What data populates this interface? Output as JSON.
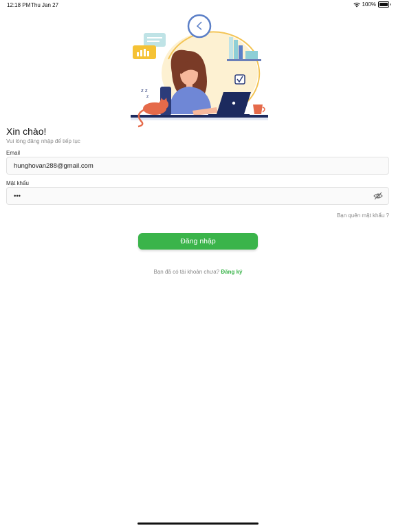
{
  "status": {
    "time": "12:18 PM",
    "date": "Thu Jan 27",
    "battery": "100%"
  },
  "greeting": "Xin chào!",
  "subtitle": "Vui lòng đăng nhập để tiếp tục",
  "email": {
    "label": "Email",
    "value": "hunghovan288@gmail.com"
  },
  "password": {
    "label": "Mật khẩu",
    "value": "•••"
  },
  "forgot_password": "Bạn quên mật khẩu ?",
  "login_button": "Đăng nhập",
  "signup": {
    "prompt": "Bạn đã có tài khoản chưa?",
    "link": "Đăng ký"
  },
  "colors": {
    "accent": "#3ab44a"
  }
}
